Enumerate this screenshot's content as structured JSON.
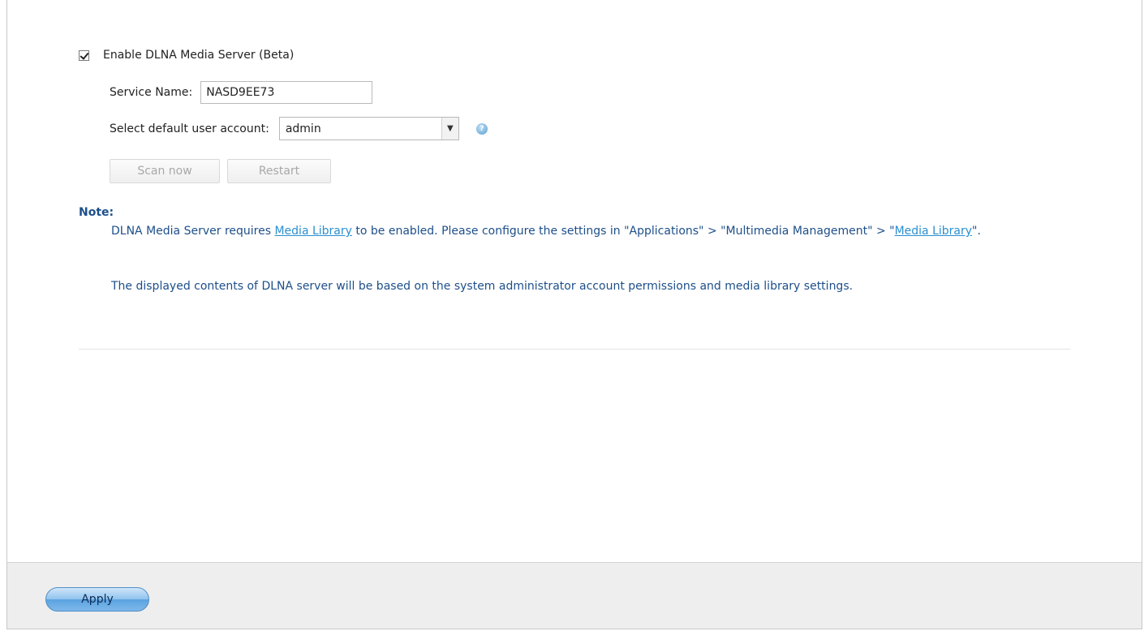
{
  "enable_label": "Enable DLNA Media Server (Beta)",
  "enable_checked": true,
  "service_name_label": "Service Name:",
  "service_name_value": "NASD9EE73",
  "default_user_label": "Select default user account:",
  "default_user_value": "admin",
  "scan_button": "Scan now",
  "restart_button": "Restart",
  "note": {
    "title": "Note:",
    "p1_before": "DLNA Media Server requires ",
    "p1_link1": "Media Library",
    "p1_middle": " to be enabled. Please configure the settings in \"Applications\" > \"Multimedia Management\" > \"",
    "p1_link2": "Media Library",
    "p1_after": "\".",
    "p2": "The displayed contents of DLNA server will be based on the system administrator account permissions and media library settings."
  },
  "apply_button": "Apply",
  "icons": {
    "help": "help-icon",
    "dropdown": "chevron-down-icon",
    "checkbox": "checkbox-checked"
  },
  "colors": {
    "note_text": "#1d4f8a",
    "link": "#2a8fd0",
    "apply_button": "#7fb8ea"
  }
}
